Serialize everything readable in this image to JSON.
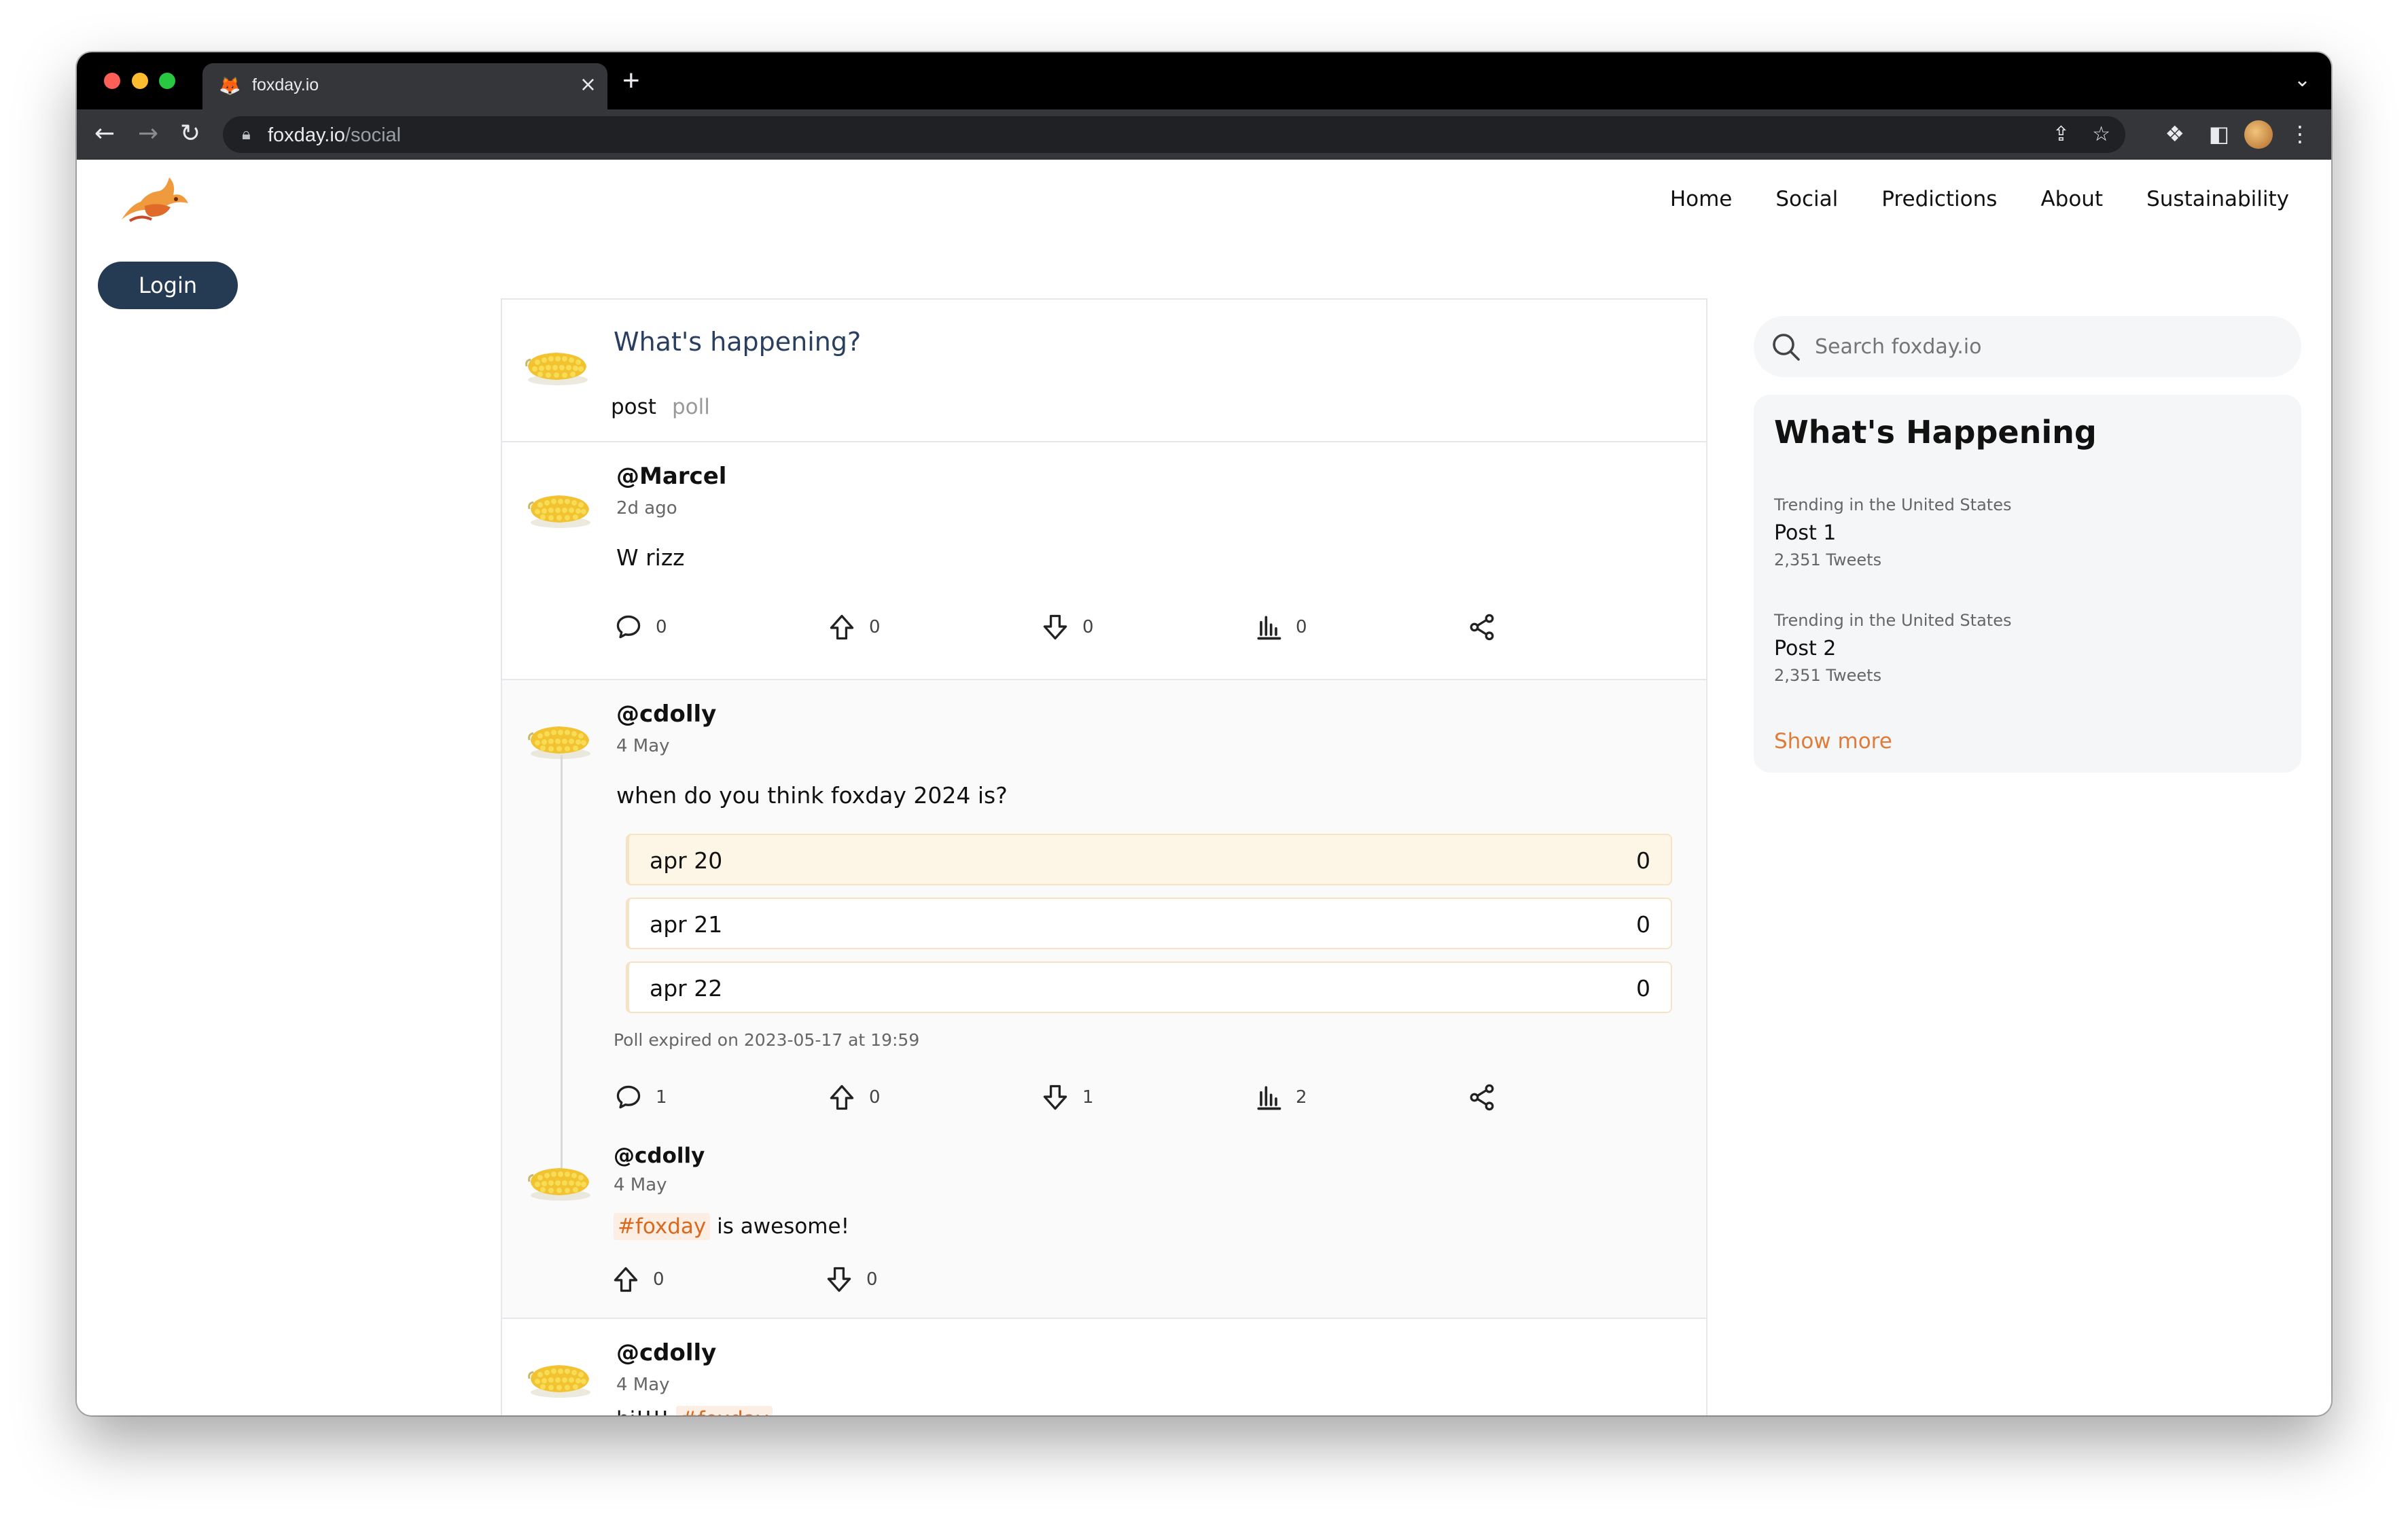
{
  "browser": {
    "tab_title": "foxday.io",
    "url_host": "foxday.io",
    "url_path": "/social",
    "new_tab_symbol": "+",
    "close_symbol": "×"
  },
  "nav": {
    "login_label": "Login",
    "links": [
      "Home",
      "Social",
      "Predictions",
      "About",
      "Sustainability"
    ]
  },
  "compose": {
    "prompt": "What's happening?",
    "mode_post": "post",
    "mode_poll": "poll"
  },
  "posts": [
    {
      "handle": "@Marcel",
      "time": "2d ago",
      "text": "W rizz",
      "comments": "0",
      "upvotes": "0",
      "downvotes": "0",
      "views": "0"
    },
    {
      "handle": "@cdolly",
      "time": "4 May",
      "text": "when do you think foxday 2024 is?",
      "poll_options": [
        {
          "label": "apr 20",
          "count": "0"
        },
        {
          "label": "apr 21",
          "count": "0"
        },
        {
          "label": "apr 22",
          "count": "0"
        }
      ],
      "poll_expired": "Poll expired on 2023-05-17 at 19:59",
      "comments": "1",
      "upvotes": "0",
      "downvotes": "1",
      "views": "2",
      "reply": {
        "handle": "@cdolly",
        "time": "4 May",
        "hashtag": "#foxday",
        "text": "is awesome!",
        "upvotes": "0",
        "downvotes": "0"
      }
    },
    {
      "handle": "@cdolly",
      "time": "4 May",
      "text": "hi!!!!",
      "hashtag": "#foxday"
    }
  ],
  "sidebar": {
    "search_placeholder": "Search foxday.io",
    "title": "What's Happening",
    "trends": [
      {
        "context": "Trending in the United States",
        "topic": "Post 1",
        "count": "2,351 Tweets"
      },
      {
        "context": "Trending in the United States",
        "topic": "Post 2",
        "count": "2,351 Tweets"
      }
    ],
    "show_more": "Show more"
  },
  "colors": {
    "accent": "#e07b39",
    "login_bg": "#243b53",
    "poll_border": "#f7e3c4"
  }
}
